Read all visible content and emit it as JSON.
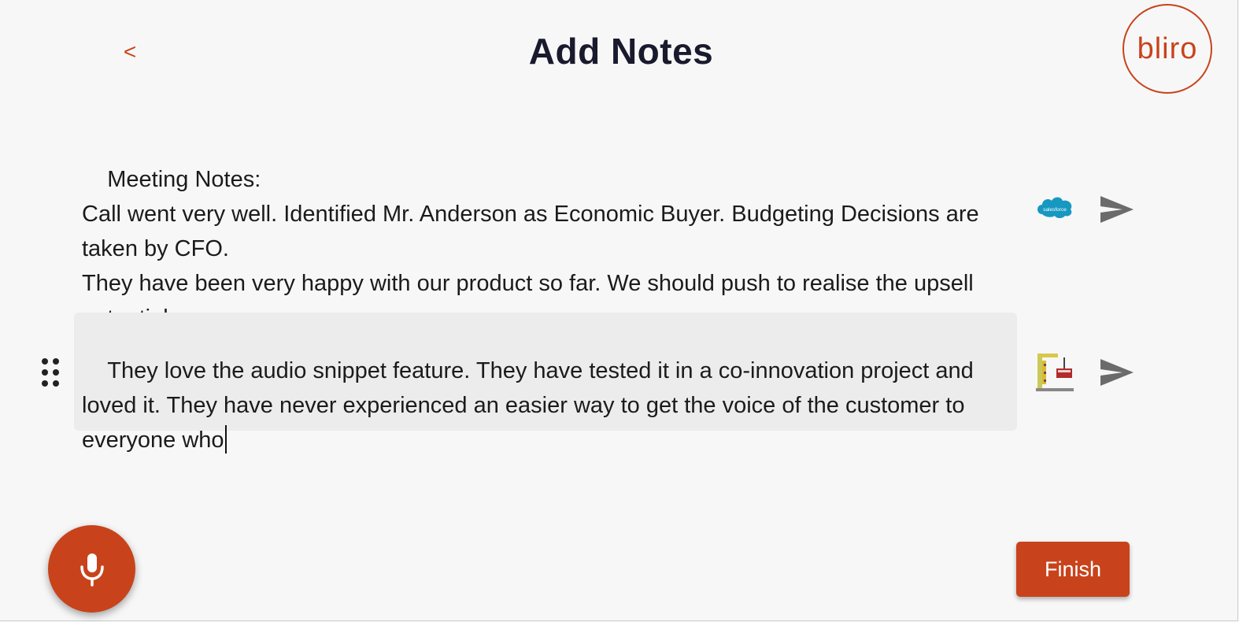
{
  "header": {
    "back_label": "<",
    "title": "Add Notes",
    "logo_text": "bliro"
  },
  "notes": [
    {
      "text": "Meeting Notes:\nCall went very well. Identified Mr. Anderson as Economic Buyer. Budgeting Decisions are taken by CFO.\nThey have been very happy with our product so far. We should push to realise the upsell potential.",
      "destination_icon": "salesforce-icon",
      "destination_label": "salesforce",
      "send_icon": "send-icon"
    },
    {
      "text": "They love the audio snippet feature. They have tested it in a co-innovation project and loved it. They have never experienced an easier way to get the voice of the customer to everyone who",
      "destination_icon": "product-board-icon",
      "send_icon": "send-icon",
      "active": true
    }
  ],
  "actions": {
    "mic_icon": "microphone-icon",
    "finish_label": "Finish"
  },
  "colors": {
    "accent": "#c8431b",
    "salesforce": "#1798c1",
    "send_arrow": "#6b6b6b",
    "active_note_bg": "#ececec"
  }
}
